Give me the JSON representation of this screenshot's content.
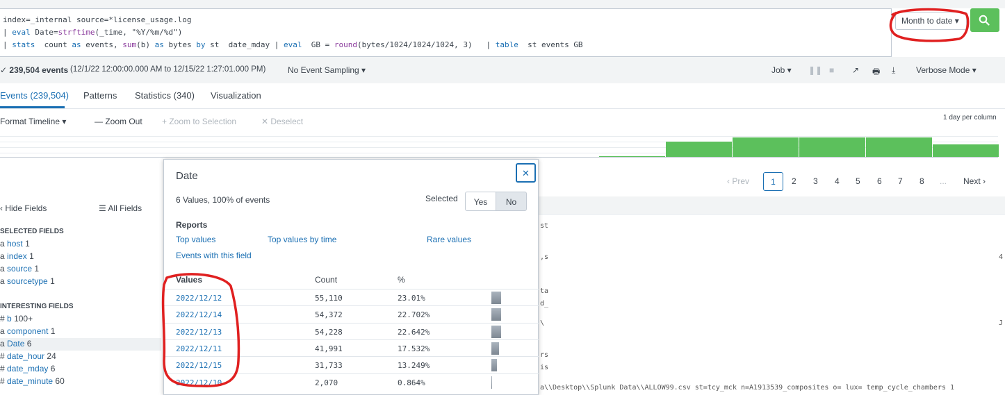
{
  "search": {
    "line1": "index=_internal source=*license_usage.log",
    "line2_pre": "| ",
    "line2_kw": "eval",
    "line2_mid": " Date=",
    "line2_fn": "strftime",
    "line2_rest": "(_time, \"%Y/%m/%d\")",
    "line3_a": "| ",
    "line3_kw1": "stats",
    "line3_b": "  count ",
    "line3_kw2": "as",
    "line3_c": " events, ",
    "line3_fn1": "sum",
    "line3_d": "(b) ",
    "line3_kw3": "as",
    "line3_e": " bytes ",
    "line3_kw4": "by",
    "line3_f": " st  date_mday | ",
    "line3_kw5": "eval",
    "line3_g": "  GB = ",
    "line3_fn2": "round",
    "line3_h": "(bytes/1024/1024/1024, 3)   | ",
    "line3_kw6": "table",
    "line3_i": "  st events GB",
    "time_range": "Month to date ▾"
  },
  "summary": {
    "events": "✓ 239,504 events",
    "range": "(12/1/22 12:00:00.000 AM to 12/15/22 1:27:01.000 PM)",
    "sampling": "No Event Sampling ▾",
    "job": "Job ▾",
    "mode": "Verbose Mode ▾"
  },
  "tabs": [
    "Events (239,504)",
    "Patterns",
    "Statistics (340)",
    "Visualization"
  ],
  "timeline": {
    "format": "Format Timeline ▾",
    "zoom_out": "— Zoom Out",
    "zoom_sel": "+ Zoom to Selection",
    "deselect": "✕ Deselect",
    "scale": "1 day per column"
  },
  "pagination": [
    "‹ Prev",
    "1",
    "2",
    "3",
    "4",
    "5",
    "6",
    "7",
    "8",
    "...",
    "Next ›"
  ],
  "sidebar": {
    "hide": "‹ Hide Fields",
    "all": "☰ All Fields",
    "selected_header": "SELECTED FIELDS",
    "selected": [
      {
        "type": "a",
        "name": "host",
        "count": "1"
      },
      {
        "type": "a",
        "name": "index",
        "count": "1"
      },
      {
        "type": "a",
        "name": "source",
        "count": "1"
      },
      {
        "type": "a",
        "name": "sourcetype",
        "count": "1"
      }
    ],
    "interesting_header": "INTERESTING FIELDS",
    "interesting": [
      {
        "type": "#",
        "name": "b",
        "count": "100+"
      },
      {
        "type": "a",
        "name": "component",
        "count": "1"
      },
      {
        "type": "a",
        "name": "Date",
        "count": "6"
      },
      {
        "type": "#",
        "name": "date_hour",
        "count": "24"
      },
      {
        "type": "#",
        "name": "date_mday",
        "count": "6"
      },
      {
        "type": "#",
        "name": "date_minute",
        "count": "60"
      }
    ]
  },
  "popup": {
    "title": "Date",
    "close": "✕",
    "subtitle": "6 Values, 100% of events",
    "selected_label": "Selected",
    "yes": "Yes",
    "no": "No",
    "reports": "Reports",
    "top_values": "Top values",
    "top_by_time": "Top values by time",
    "rare": "Rare values",
    "events_with": "Events with this field",
    "col_values": "Values",
    "col_count": "Count",
    "col_pct": "%",
    "rows": [
      {
        "value": "2022/12/12",
        "count": "55,110",
        "pct": "23.01%",
        "frac": 0.2301
      },
      {
        "value": "2022/12/14",
        "count": "54,372",
        "pct": "22.702%",
        "frac": 0.22702
      },
      {
        "value": "2022/12/13",
        "count": "54,228",
        "pct": "22.642%",
        "frac": 0.22642
      },
      {
        "value": "2022/12/11",
        "count": "41,991",
        "pct": "17.532%",
        "frac": 0.17532
      },
      {
        "value": "2022/12/15",
        "count": "31,733",
        "pct": "13.249%",
        "frac": 0.13249
      },
      {
        "value": "2022/12/10",
        "count": "2,070",
        "pct": "0.864%",
        "frac": 0.00864
      }
    ]
  },
  "timeline_bars": [
    0.02,
    0.33,
    0.43,
    0.43,
    0.43,
    0.27
  ],
  "bottom_text": "a\\\\Desktop\\\\Splunk Data\\\\ALLOW99.csv  st=tcy_mck n=A1913539_composites o=   lux= temp_cycle_chambers  1",
  "colors": {
    "accent": "#1a6fb3",
    "green": "#5cc05c",
    "annotation": "#e02020"
  }
}
